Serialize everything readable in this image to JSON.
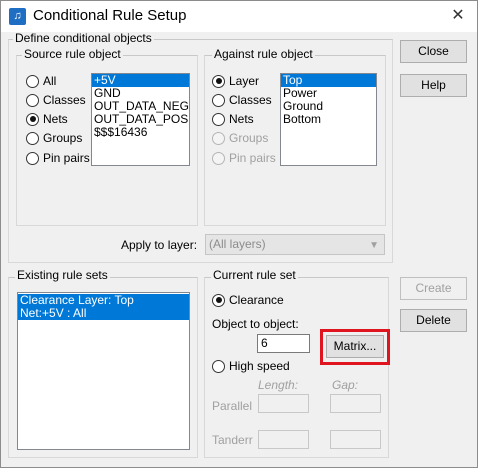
{
  "window": {
    "title": "Conditional Rule Setup",
    "icon": "app-icon",
    "close_glyph": "✕"
  },
  "define": {
    "label": "Define conditional objects",
    "source": {
      "label": "Source rule object",
      "options": [
        {
          "label": "All",
          "checked": false,
          "enabled": true
        },
        {
          "label": "Classes",
          "checked": false,
          "enabled": true
        },
        {
          "label": "Nets",
          "checked": true,
          "enabled": true
        },
        {
          "label": "Groups",
          "checked": false,
          "enabled": true
        },
        {
          "label": "Pin pairs",
          "checked": false,
          "enabled": true
        }
      ],
      "list": [
        "+5V",
        "GND",
        "OUT_DATA_NEG",
        "OUT_DATA_POS",
        "$$$16436"
      ],
      "selected_index": 0
    },
    "against": {
      "label": "Against rule object",
      "options": [
        {
          "label": "Layer",
          "checked": true,
          "enabled": true
        },
        {
          "label": "Classes",
          "checked": false,
          "enabled": true
        },
        {
          "label": "Nets",
          "checked": false,
          "enabled": true
        },
        {
          "label": "Groups",
          "checked": false,
          "enabled": false
        },
        {
          "label": "Pin pairs",
          "checked": false,
          "enabled": false
        }
      ],
      "list": [
        "Top",
        "Power",
        "Ground",
        "Bottom"
      ],
      "selected_index": 0
    },
    "apply_to_layer": {
      "label": "Apply to layer:",
      "value": "(All layers)"
    }
  },
  "existing": {
    "label": "Existing rule sets",
    "items": [
      "Clearance  Layer: Top",
      "Net:+5V :  All"
    ]
  },
  "current": {
    "label": "Current rule set",
    "clearance_label": "Clearance",
    "object_to_object_label": "Object to object:",
    "object_to_object_value": "6",
    "matrix_label": "Matrix...",
    "high_speed_label": "High speed",
    "length_label": "Length:",
    "gap_label": "Gap:",
    "parallel_label": "Parallel",
    "tandem_label": "Tanderr"
  },
  "buttons": {
    "close": "Close",
    "help": "Help",
    "create": "Create",
    "delete": "Delete"
  },
  "colors": {
    "selection": "#0078d7",
    "highlight": "#e0141e"
  }
}
